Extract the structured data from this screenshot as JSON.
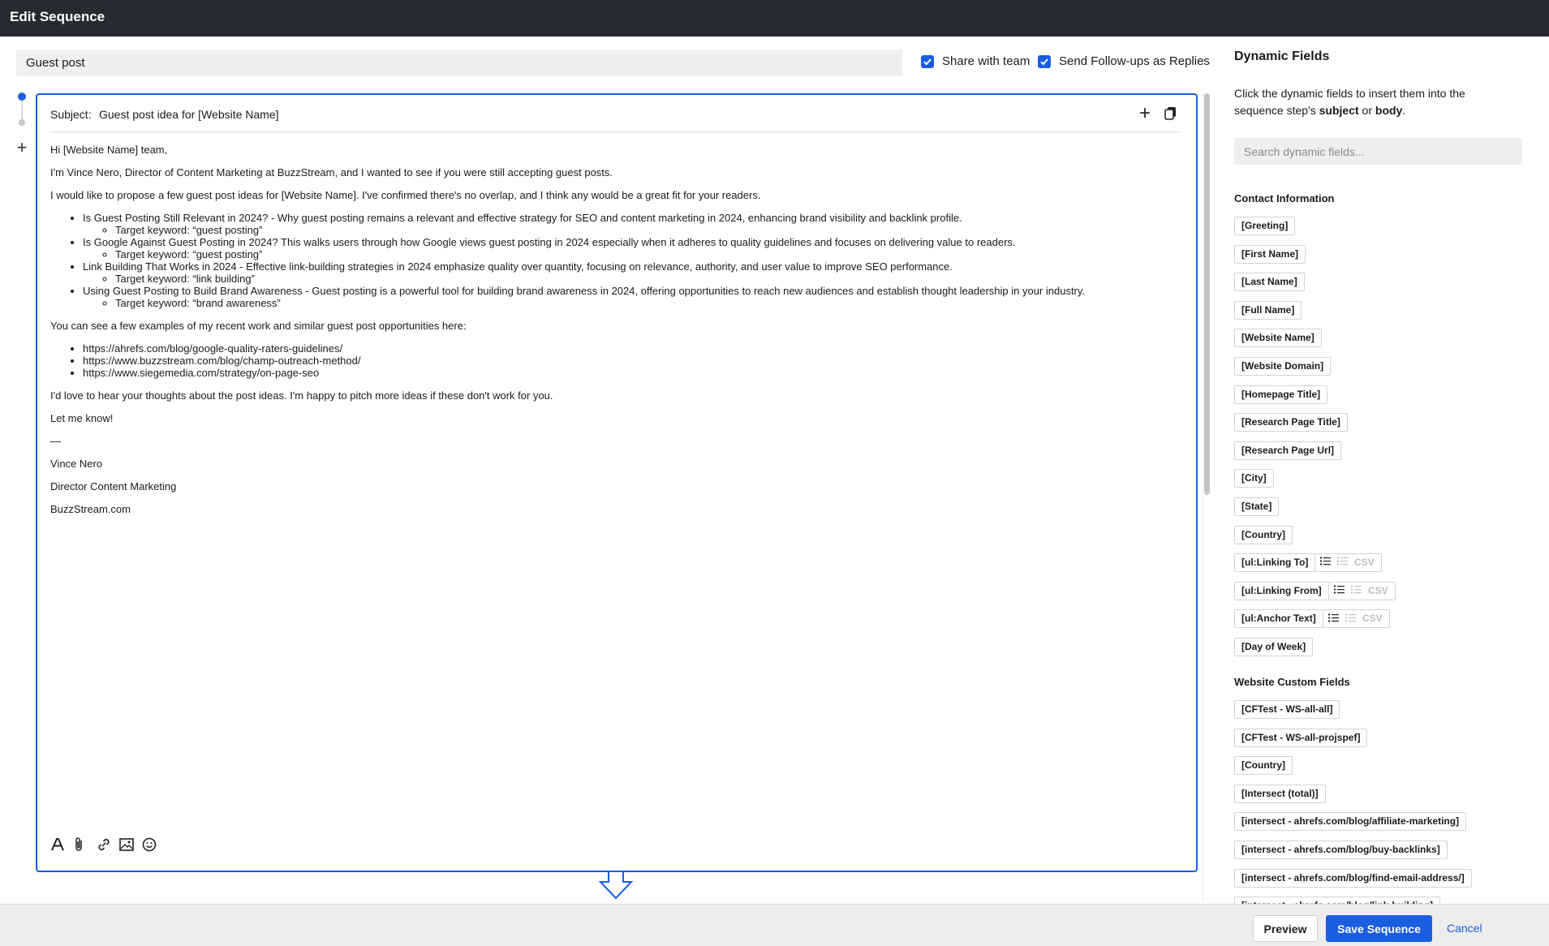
{
  "window": {
    "title": "Edit Sequence"
  },
  "sequence": {
    "name": "Guest post",
    "share_label": "Share with team",
    "share_checked": true,
    "followups_label": "Send Follow-ups as Replies",
    "followups_checked": true
  },
  "step": {
    "subject_label": "Subject:",
    "subject": "Guest post idea for [Website Name]",
    "greeting": "Hi [Website Name] team,",
    "intro": "I'm Vince Nero, Director of Content Marketing at BuzzStream, and I wanted to see if you were still accepting guest posts.",
    "proposal": "I would like to propose a few guest post ideas for [Website Name]. I've confirmed there's no overlap, and I think any would be a great fit for your readers.",
    "ideas": [
      {
        "text": "Is Guest Posting Still Relevant in 2024? - Why guest posting remains a relevant and effective strategy for SEO and content marketing in 2024, enhancing brand visibility and backlink profile.",
        "keyword": "Target keyword: “guest posting”"
      },
      {
        "text": "Is Google Against Guest Posting in 2024? This walks users through how Google views guest posting in 2024 especially when it adheres to quality guidelines and focuses on delivering value to readers.",
        "keyword": "Target keyword: “guest posting”"
      },
      {
        "text": "Link Building That Works in 2024 - Effective link-building strategies in 2024 emphasize quality over quantity, focusing on relevance, authority, and user value to improve SEO performance.",
        "keyword": "Target keyword: “link building”"
      },
      {
        "text": "Using Guest Posting to Build Brand Awareness - Guest posting is a powerful tool for building brand awareness in 2024, offering opportunities to reach new audiences and establish thought leadership in your industry.",
        "keyword": "Target keyword: “brand awareness”"
      }
    ],
    "examples_intro": "You can see a few examples of my recent work and similar guest post opportunities here:",
    "links": [
      "https://ahrefs.com/blog/google-quality-raters-guidelines/",
      "https://www.buzzstream.com/blog/champ-outreach-method/",
      "https://www.siegemedia.com/strategy/on-page-seo"
    ],
    "closing": "I'd love to hear your thoughts about the post ideas. I'm happy to pitch more ideas if these don't work for you.",
    "cta": "Let me know!",
    "sig_sep": "—",
    "sig_name": "Vince Nero",
    "sig_title": "Director Content Marketing",
    "sig_company": "BuzzStream.com"
  },
  "sidebar": {
    "title": "Dynamic Fields",
    "desc_prefix": "Click the dynamic fields to insert them into the sequence step's ",
    "desc_subject": "subject",
    "desc_or": " or ",
    "desc_body": "body",
    "desc_suffix": ".",
    "search_placeholder": "Search dynamic fields...",
    "contact_heading": "Contact Information",
    "contact_fields": [
      {
        "label": "[Greeting]"
      },
      {
        "label": "[First Name]"
      },
      {
        "label": "[Last Name]"
      },
      {
        "label": "[Full Name]"
      },
      {
        "label": "[Website Name]"
      },
      {
        "label": "[Website Domain]"
      },
      {
        "label": "[Homepage Title]"
      },
      {
        "label": "[Research Page Title]"
      },
      {
        "label": "[Research Page Url]"
      },
      {
        "label": "[City]"
      },
      {
        "label": "[State]"
      },
      {
        "label": "[Country]"
      },
      {
        "label": "[ul:Linking To]",
        "csv": "CSV"
      },
      {
        "label": "[ul:Linking From]",
        "csv": "CSV"
      },
      {
        "label": "[ul:Anchor Text]",
        "csv": "CSV"
      },
      {
        "label": "[Day of Week]"
      }
    ],
    "custom_heading": "Website Custom Fields",
    "custom_fields": [
      "[CFTest - WS-all-all]",
      "[CFTest - WS-all-projspef]",
      "[Country]",
      "[Intersect (total)]",
      "[intersect - ahrefs.com/blog/affiliate-marketing]",
      "[intersect - ahrefs.com/blog/buy-backlinks]",
      "[intersect - ahrefs.com/blog/find-email-address/]",
      "[intersect - ahrefs.com/blog/link-building]"
    ]
  },
  "footer": {
    "preview_label": "Preview",
    "save_label": "Save Sequence",
    "cancel_label": "Cancel"
  },
  "colors": {
    "accent": "#1a5de0",
    "titlebar": "#272b31",
    "input_bg": "#efefef"
  }
}
